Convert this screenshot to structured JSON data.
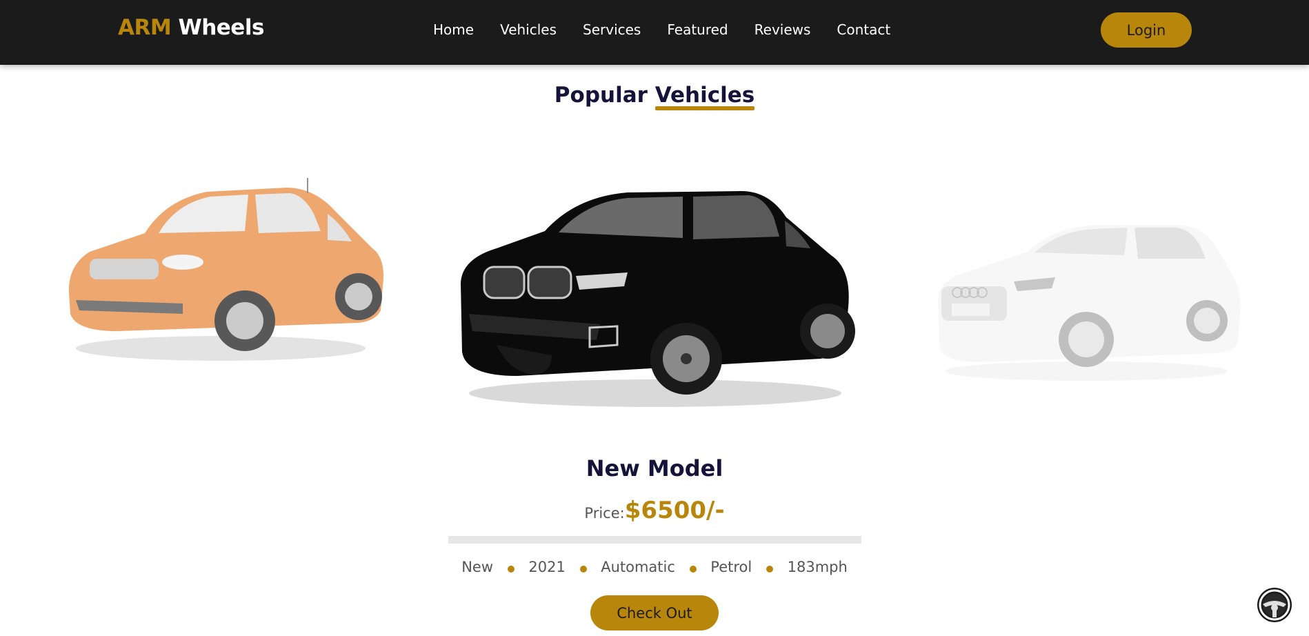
{
  "header": {
    "logo_accent": "ARM",
    "logo_main": " Wheels",
    "nav": [
      "Home",
      "Vehicles",
      "Services",
      "Featured",
      "Reviews",
      "Contact"
    ],
    "login_label": "Login"
  },
  "section": {
    "heading_part1": "Popular ",
    "heading_part2": "Vehicles"
  },
  "carousel": {
    "cars": [
      {
        "name": "orange-suv",
        "color": "#e88f47"
      },
      {
        "name": "black-suv",
        "color": "#0b0b0b"
      },
      {
        "name": "white-suv",
        "color": "#f2f2f2"
      }
    ]
  },
  "active_vehicle": {
    "title": "New Model",
    "price_label": "Price:",
    "price_value": "$6500/-",
    "specs": [
      "New",
      "2021",
      "Automatic",
      "Petrol",
      "183mph"
    ],
    "cta_label": "Check Out"
  },
  "colors": {
    "accent": "#b8860b",
    "header_bg": "#1c1b1b",
    "heading": "#16133a"
  },
  "icons": {
    "floating": "steering-wheel-icon"
  }
}
